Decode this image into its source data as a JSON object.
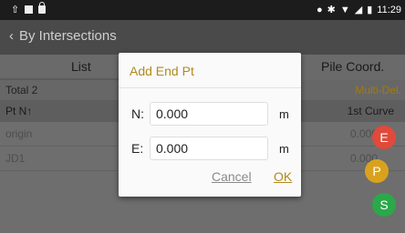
{
  "status_bar": {
    "time": "11:29"
  },
  "app_bar": {
    "back_label": "By Intersections"
  },
  "tabs": [
    {
      "label": "List"
    },
    {
      "label": "Pile Coord."
    }
  ],
  "summary": {
    "total": "Total 2",
    "multi_del": "Multi-Del."
  },
  "table": {
    "header_left": "Pt N↑",
    "header_right": "1st Curve",
    "rows": [
      {
        "name": "origin",
        "value": "0.000"
      },
      {
        "name": "JD1",
        "value": "0.000"
      }
    ]
  },
  "fabs": [
    {
      "label": "E",
      "color": "#e04a3a"
    },
    {
      "label": "P",
      "color": "#d9a21e"
    },
    {
      "label": "S",
      "color": "#2aa84a"
    }
  ],
  "dialog": {
    "title": "Add End Pt",
    "fields": [
      {
        "label": "N:",
        "value": "0.000",
        "unit": "m"
      },
      {
        "label": "E:",
        "value": "0.000",
        "unit": "m"
      }
    ],
    "cancel_label": "Cancel",
    "ok_label": "OK"
  }
}
